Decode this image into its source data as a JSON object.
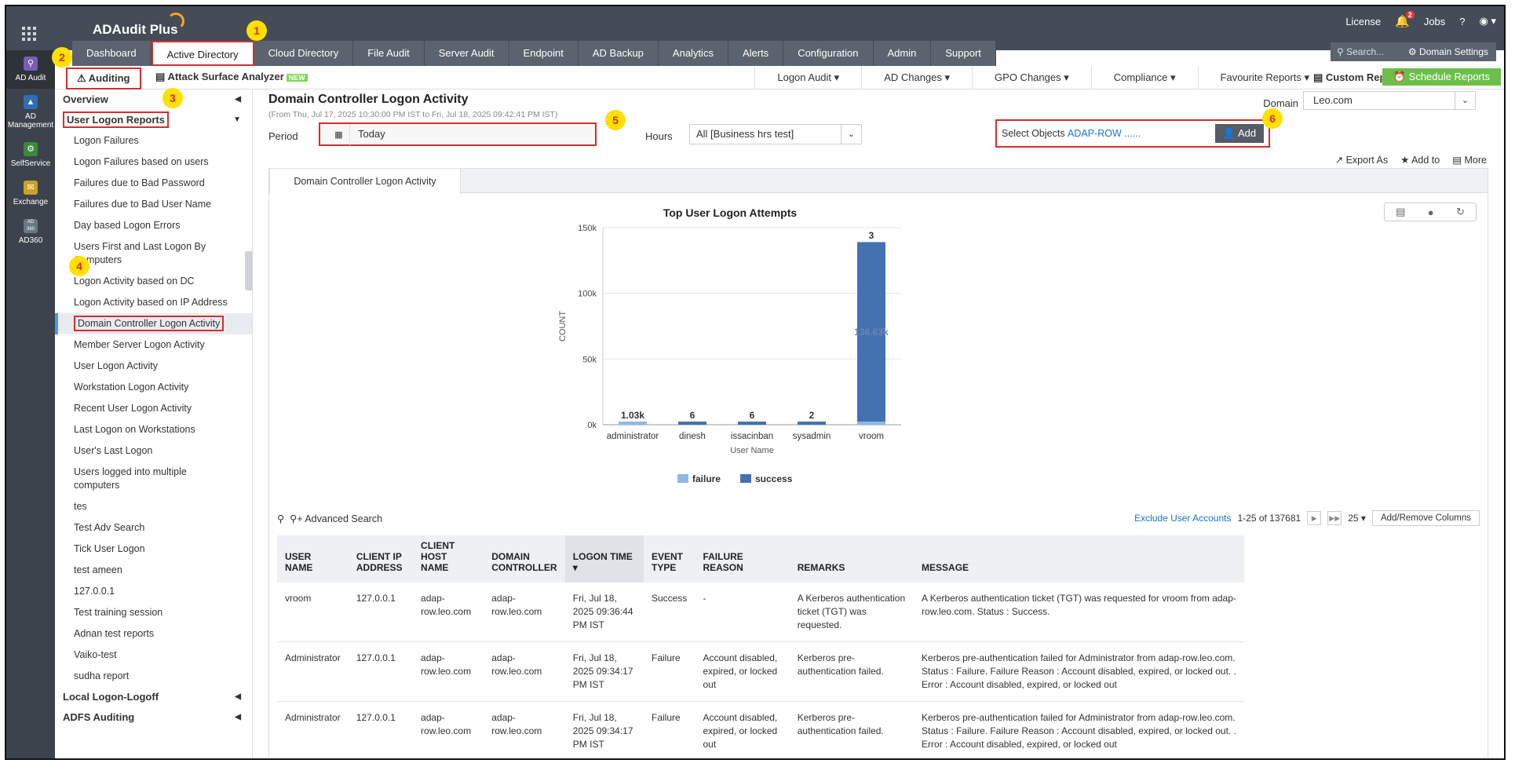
{
  "app": {
    "title": "ADAudit Plus",
    "top_links": [
      "License",
      "Jobs",
      "?"
    ],
    "notification_count": "2"
  },
  "nav": {
    "tabs": [
      "Dashboard",
      "Active Directory",
      "Cloud Directory",
      "File Audit",
      "Server Audit",
      "Endpoint",
      "AD Backup",
      "Analytics",
      "Alerts",
      "Configuration",
      "Admin",
      "Support"
    ],
    "active": "Active Directory",
    "search_placeholder": "Search...",
    "domain_settings": "Domain Settings"
  },
  "rail": [
    {
      "label": "AD Audit",
      "icon": "ad-audit-icon"
    },
    {
      "label": "AD Management",
      "icon": "ad-management-icon"
    },
    {
      "label": "SelfService",
      "icon": "selfservice-icon"
    },
    {
      "label": "Exchange",
      "icon": "exchange-icon"
    },
    {
      "label": "AD360",
      "icon": "ad360-icon"
    }
  ],
  "rail_ad360_badge": "AD 360",
  "subbar": {
    "auditing": "Auditing",
    "attack_surface": "Attack Surface Analyzer",
    "new_badge": "NEW",
    "menus": [
      "Logon Audit",
      "AD Changes",
      "GPO Changes",
      "Compliance",
      "Favourite Reports"
    ],
    "custom_reports": "Custom Reports",
    "schedule_reports": "Schedule Reports"
  },
  "sidebar": {
    "overview": "Overview",
    "section": "User Logon Reports",
    "items": [
      "Logon Failures",
      "Logon Failures based on users",
      "Failures due to Bad Password",
      "Failures due to Bad User Name",
      "Day based Logon Errors",
      "Users First and Last Logon By Computers",
      "Logon Activity based on DC",
      "Logon Activity based on IP Address",
      "Domain Controller Logon Activity",
      "Member Server Logon Activity",
      "User Logon Activity",
      "Workstation Logon Activity",
      "Recent User Logon Activity",
      "Last Logon on Workstations",
      "User's Last Logon",
      "Users logged into multiple computers",
      "tes",
      "Test Adv Search",
      "Tick User Logon",
      "test ameen",
      "127.0.0.1",
      "Test training session",
      "Adnan test reports",
      "Vaiko-test",
      "sudha report"
    ],
    "active": "Domain Controller Logon Activity",
    "bottom_sections": [
      "Local Logon-Logoff",
      "ADFS Auditing"
    ]
  },
  "report": {
    "title": "Domain Controller Logon Activity",
    "subtitle": "(From Thu, Jul 17, 2025 10:30:00 PM IST to Fri, Jul 18, 2025 09:42:41 PM IST)",
    "domain_label": "Domain",
    "domain_value": "Leo.com",
    "period_label": "Period",
    "period_value": "Today",
    "hours_label": "Hours",
    "hours_value": "All [Business hrs test]",
    "select_objects_label": "Select Objects",
    "select_objects_value": "ADAP-ROW ......",
    "add_button": "Add",
    "actions": [
      "Export As",
      "Add to",
      "More"
    ],
    "tab": "Domain Controller Logon Activity"
  },
  "chart_data": {
    "type": "bar",
    "title": "Top User Logon Attempts",
    "xlabel": "User Name",
    "ylabel": "COUNT",
    "categories": [
      "administrator",
      "dinesh",
      "issacinban",
      "sysadmin",
      "vroom"
    ],
    "series": [
      {
        "name": "failure",
        "color": "#8db8e8",
        "values": [
          1030,
          0,
          0,
          0,
          3
        ]
      },
      {
        "name": "success",
        "color": "#4472b0",
        "values": [
          0,
          6,
          6,
          2,
          136630
        ]
      }
    ],
    "data_labels": [
      "1.03k",
      "6",
      "6",
      "2",
      "3",
      "136.63k"
    ],
    "yticks": [
      "150k",
      "100k",
      "50k",
      "0k"
    ],
    "ylim": [
      0,
      150000
    ]
  },
  "table": {
    "advanced_search": "Advanced Search",
    "exclude": "Exclude User Accounts",
    "range": "1-25 of 137681",
    "page_size": "25",
    "add_remove": "Add/Remove Columns",
    "columns": [
      "USER NAME",
      "CLIENT IP ADDRESS",
      "CLIENT HOST NAME",
      "DOMAIN CONTROLLER",
      "LOGON TIME",
      "EVENT TYPE",
      "FAILURE REASON",
      "REMARKS",
      "MESSAGE"
    ],
    "rows": [
      [
        "vroom",
        "127.0.0.1",
        "adap-row.leo.com",
        "adap-row.leo.com",
        "Fri, Jul 18, 2025 09:36:44 PM IST",
        "Success",
        "-",
        "A Kerberos authentication ticket (TGT) was requested.",
        "A Kerberos authentication ticket (TGT) was requested for vroom from adap-row.leo.com. Status : Success."
      ],
      [
        "Administrator",
        "127.0.0.1",
        "adap-row.leo.com",
        "adap-row.leo.com",
        "Fri, Jul 18, 2025 09:34:17 PM IST",
        "Failure",
        "Account disabled, expired, or locked out",
        "Kerberos pre-authentication failed.",
        "Kerberos pre-authentication failed for Administrator from adap-row.leo.com. Status : Failure. Failure Reason : Account disabled, expired, or locked out. . Error : Account disabled, expired, or locked out"
      ],
      [
        "Administrator",
        "127.0.0.1",
        "adap-row.leo.com",
        "adap-row.leo.com",
        "Fri, Jul 18, 2025 09:34:17 PM IST",
        "Failure",
        "Account disabled, expired, or locked out",
        "Kerberos pre-authentication failed.",
        "Kerberos pre-authentication failed for Administrator from adap-row.leo.com. Status : Failure. Failure Reason : Account disabled, expired, or locked out. . Error : Account disabled, expired, or locked out"
      ]
    ]
  },
  "markers": [
    "1",
    "2",
    "3",
    "4",
    "5",
    "6"
  ]
}
